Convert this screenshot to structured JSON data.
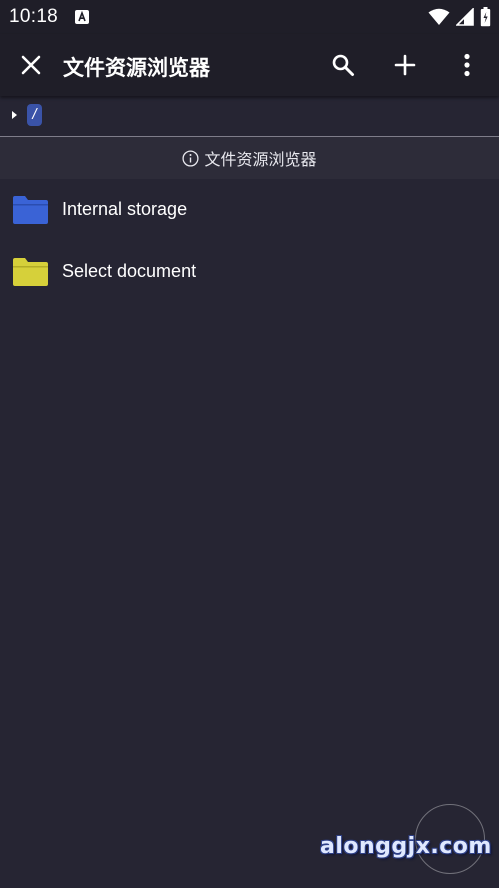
{
  "status_bar": {
    "time": "10:18"
  },
  "app_bar": {
    "title": "文件资源浏览器"
  },
  "path_bar": {
    "current_path": "/"
  },
  "info_banner": {
    "text": "文件资源浏览器"
  },
  "entries": [
    {
      "label": "Internal storage",
      "folder_color": "#3a63d6"
    },
    {
      "label": "Select document",
      "folder_color": "#d6d03a"
    }
  ],
  "watermark": {
    "text": "alonggjx.com"
  },
  "colors": {
    "background": "#262533",
    "app_bar": "#1f1e28",
    "accent_blue": "#3a53a8"
  }
}
